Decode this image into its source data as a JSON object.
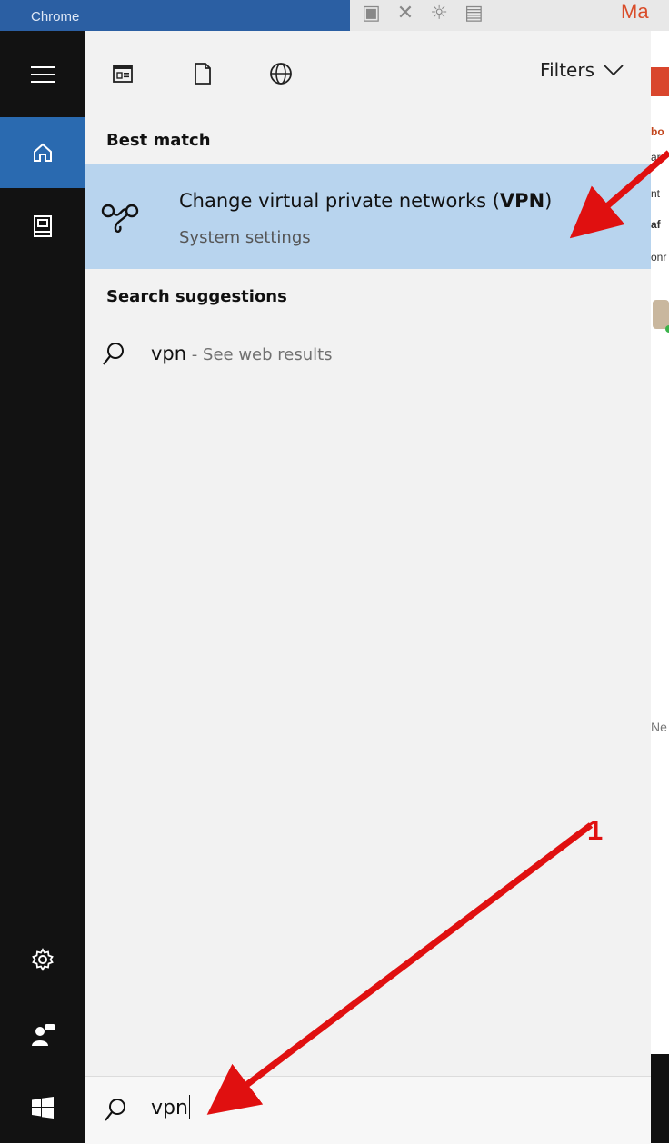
{
  "background": {
    "chrome_label": "Chrome",
    "mail_label": "Ma",
    "right_lines": [
      "bo",
      "arr",
      "nt",
      "af",
      "onr",
      "Ne"
    ]
  },
  "rail": {
    "items": [
      {
        "name": "hamburger-menu-icon"
      },
      {
        "name": "home-icon"
      },
      {
        "name": "documents-icon"
      },
      {
        "name": "settings-icon"
      },
      {
        "name": "user-feedback-icon"
      },
      {
        "name": "windows-start-icon"
      }
    ]
  },
  "toolbar": {
    "filters_label": "Filters"
  },
  "results": {
    "best_match_heading": "Best match",
    "best_match": {
      "title_prefix": "Change virtual private networks (",
      "title_bold": "VPN",
      "title_suffix": ")",
      "subtitle": "System settings"
    },
    "suggestions_heading": "Search suggestions",
    "suggestion": {
      "query": "vpn",
      "hint": " - See web results"
    }
  },
  "search": {
    "value": "vpn"
  },
  "annotation": {
    "step_number": "1",
    "arrow_color": "#e01010"
  },
  "colors": {
    "accent": "#2a6ab0",
    "selection": "#b8d4ee",
    "rail": "#121212"
  }
}
